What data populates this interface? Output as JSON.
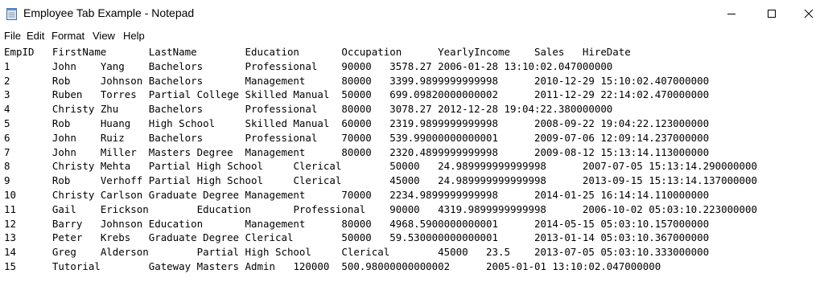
{
  "window": {
    "title": "Employee Tab Example - Notepad"
  },
  "menu": [
    {
      "label": "File"
    },
    {
      "label": "Edit"
    },
    {
      "label": "Format"
    },
    {
      "label": "View"
    },
    {
      "label": "Help"
    }
  ],
  "document": {
    "lines": [
      "EmpID\tFirstName\tLastName\tEducation\tOccupation\tYearlyIncome\tSales\tHireDate",
      "1\tJohn\tYang\tBachelors\tProfessional\t90000\t3578.27\t2006-01-28 13:10:02.047000000",
      "2\tRob\tJohnson\tBachelors\tManagement\t80000\t3399.9899999999998\t2010-12-29 15:10:02.407000000",
      "3\tRuben\tTorres\tPartial College\tSkilled Manual\t50000\t699.09820000000002\t2011-12-29 22:14:02.470000000",
      "4\tChristy\tZhu\tBachelors\tProfessional\t80000\t3078.27\t2012-12-28 19:04:22.380000000",
      "5\tRob\tHuang\tHigh School\tSkilled Manual\t60000\t2319.9899999999998\t2008-09-22 19:04:22.123000000",
      "6\tJohn\tRuiz\tBachelors\tProfessional\t70000\t539.99000000000001\t2009-07-06 12:09:14.237000000",
      "7\tJohn\tMiller\tMasters Degree\tManagement\t80000\t2320.4899999999998\t2009-08-12 15:13:14.113000000",
      "8\tChristy\tMehta\tPartial High School\tClerical\t50000\t24.989999999999998\t2007-07-05 15:13:14.290000000",
      "9\tRob\tVerhoff\tPartial High School\tClerical\t45000\t24.989999999999998\t2013-09-15 15:13:14.137000000",
      "10\tChristy\tCarlson\tGraduate Degree\tManagement\t70000\t2234.9899999999998\t2014-01-25 16:14:14.110000000",
      "11\tGail\tErickson\tEducation\tProfessional\t90000\t4319.9899999999998\t2006-10-02 05:03:10.223000000",
      "12\tBarry\tJohnson\tEducation\tManagement\t80000\t4968.5900000000001\t2014-05-15 05:03:10.157000000",
      "13\tPeter\tKrebs\tGraduate Degree\tClerical\t50000\t59.530000000000001\t2013-01-14 05:03:10.367000000",
      "14\tGreg\tAlderson\tPartial High School\tClerical\t45000\t23.5\t2013-07-05 05:03:10.333000000",
      "15\tTutorial\tGateway\tMasters\tAdmin\t120000\t500.98000000000002\t2005-01-01 13:10:02.047000000"
    ]
  }
}
